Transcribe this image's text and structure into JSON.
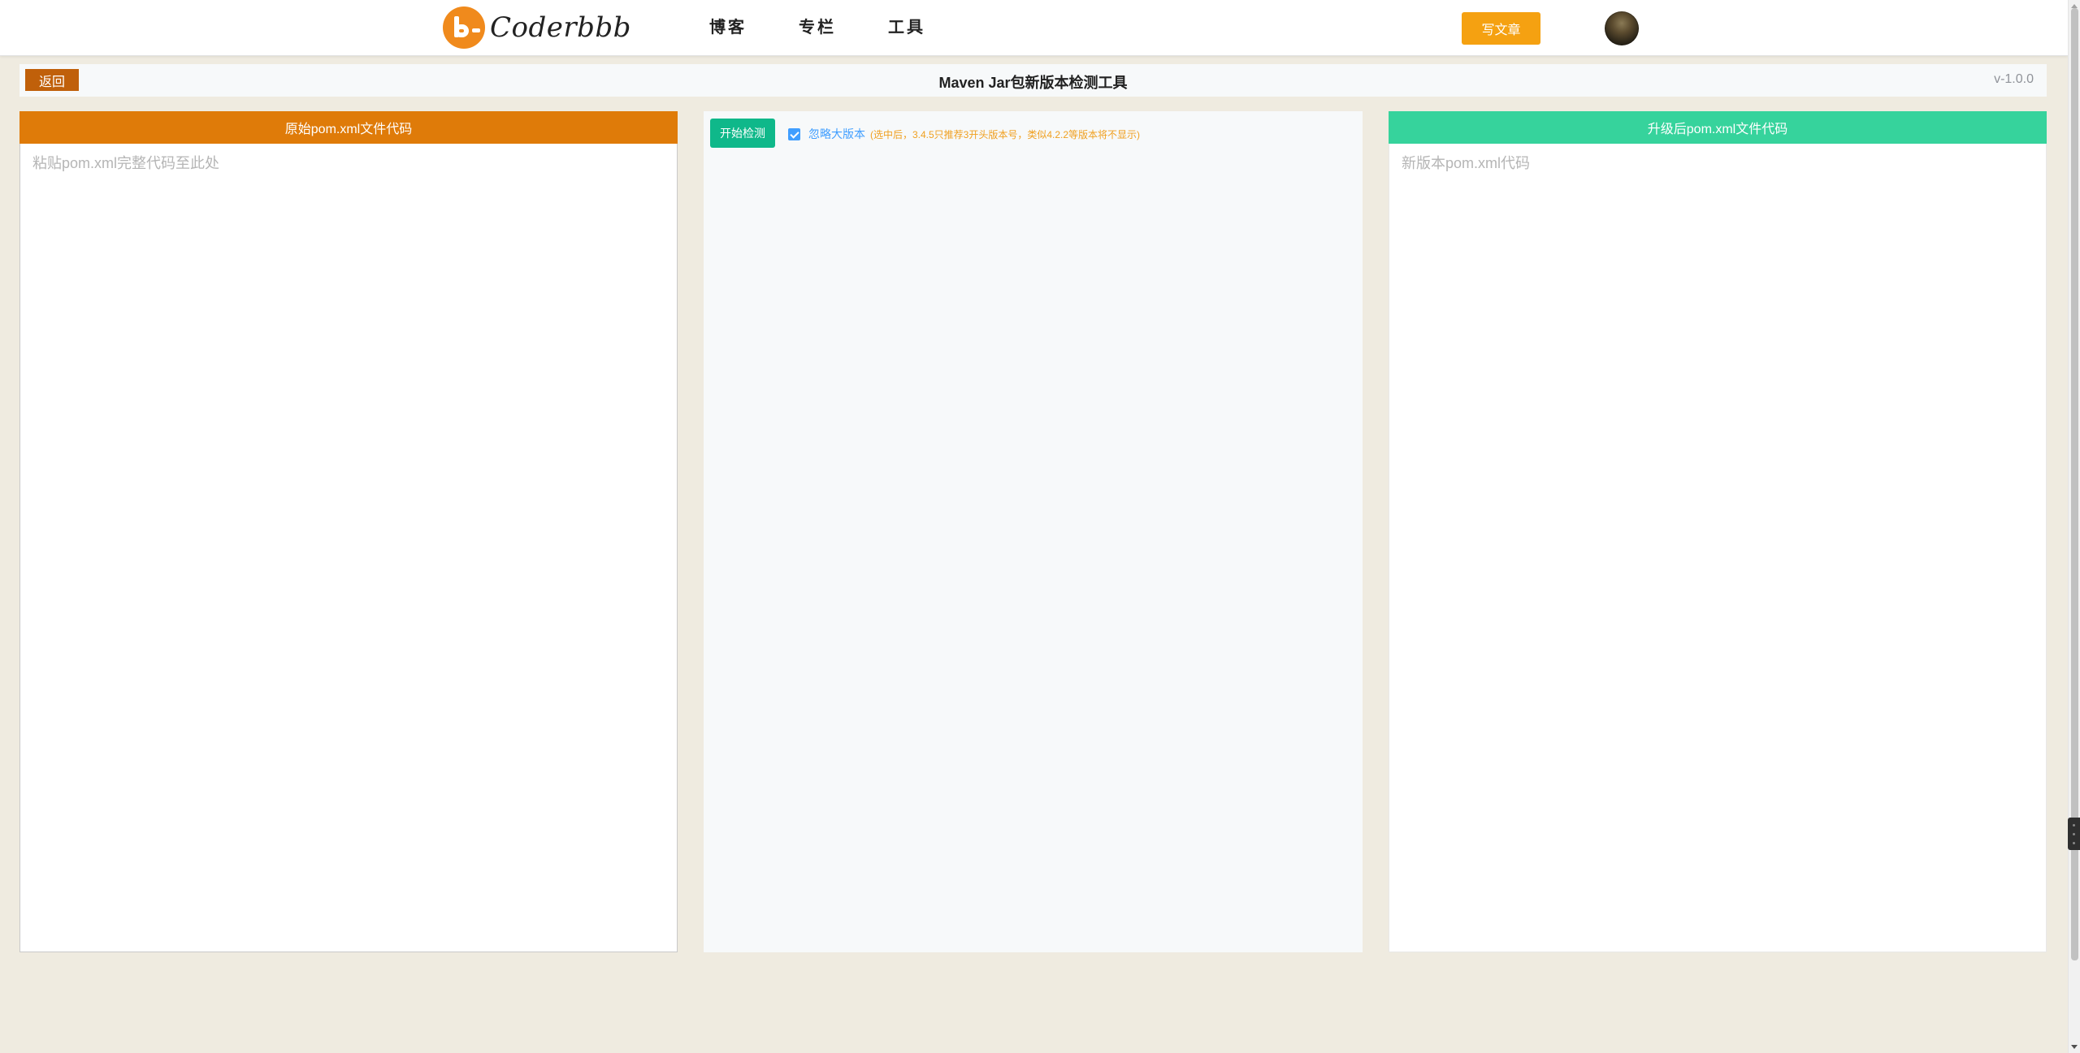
{
  "header": {
    "logo_text": "Coderbbb",
    "nav": [
      {
        "label": "博客"
      },
      {
        "label": "专栏"
      },
      {
        "label": "工具"
      }
    ],
    "write_button": "写文章"
  },
  "toolbar": {
    "back_label": "返回",
    "title": "Maven Jar包新版本检测工具",
    "version": "v-1.0.0"
  },
  "left_panel": {
    "title": "原始pom.xml文件代码",
    "placeholder": "粘贴pom.xml完整代码至此处",
    "value": ""
  },
  "middle_panel": {
    "check_button": "开始检测",
    "ignore_major_label": "忽略大版本",
    "ignore_major_checked": true,
    "ignore_major_hint": "(选中后，3.4.5只推荐3开头版本号，类似4.2.2等版本将不显示)"
  },
  "right_panel": {
    "title": "升级后pom.xml文件代码",
    "placeholder": "新版本pom.xml代码",
    "value": ""
  },
  "colors": {
    "accent_orange": "#df7b09",
    "accent_green": "#36d39c",
    "button_green": "#0fb88a",
    "write_button": "#f5a111",
    "back_button": "#c0600a",
    "checkbox_blue": "#409eff",
    "page_background": "#efebe0"
  }
}
